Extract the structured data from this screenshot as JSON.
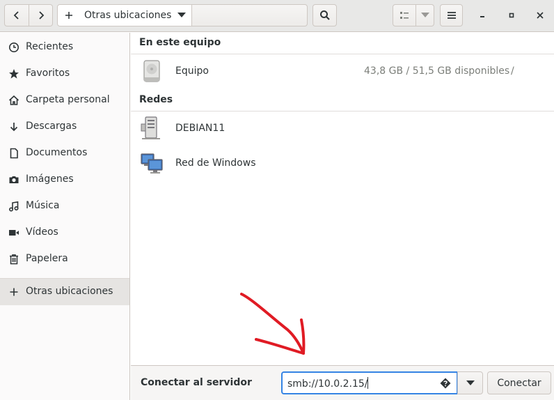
{
  "header": {
    "back_icon": "chevron-left-icon",
    "forward_icon": "chevron-right-icon",
    "path_icon": "plus-icon",
    "path_label": "Otras ubicaciones",
    "path_menu_icon": "triangle-down-icon",
    "search_icon": "search-icon",
    "view_list_icon": "list-view-icon",
    "view_menu_icon": "triangle-down-icon",
    "main_menu_icon": "hamburger-icon",
    "minimize_icon": "minimize-icon",
    "maximize_icon": "maximize-icon",
    "close_icon": "close-icon"
  },
  "sidebar": {
    "items": [
      {
        "label": "Recientes",
        "icon": "clock-icon"
      },
      {
        "label": "Favoritos",
        "icon": "star-icon"
      },
      {
        "label": "Carpeta personal",
        "icon": "home-icon"
      },
      {
        "label": "Descargas",
        "icon": "arrow-down-icon"
      },
      {
        "label": "Documentos",
        "icon": "document-icon"
      },
      {
        "label": "Imágenes",
        "icon": "camera-icon"
      },
      {
        "label": "Música",
        "icon": "music-icon"
      },
      {
        "label": "Vídeos",
        "icon": "video-icon"
      },
      {
        "label": "Papelera",
        "icon": "trash-icon"
      }
    ],
    "other": {
      "label": "Otras ubicaciones",
      "icon": "plus-icon"
    }
  },
  "main": {
    "this_computer": {
      "heading": "En este equipo",
      "items": [
        {
          "name": "Equipo",
          "info": "43,8 GB / 51,5 GB disponibles",
          "mount": "/",
          "icon": "drive-icon"
        }
      ]
    },
    "networks": {
      "heading": "Redes",
      "items": [
        {
          "name": "DEBIAN11",
          "icon": "server-icon"
        },
        {
          "name": "Red de Windows",
          "icon": "network-icon"
        }
      ]
    }
  },
  "action_bar": {
    "label": "Conectar al servidor",
    "input_value": "smb://10.0.2.15/",
    "help_icon": "help-icon",
    "dropdown_icon": "triangle-down-icon",
    "connect_label": "Conectar"
  },
  "colors": {
    "accent": "#3584e4",
    "annotation_arrow": "#e01b24"
  }
}
